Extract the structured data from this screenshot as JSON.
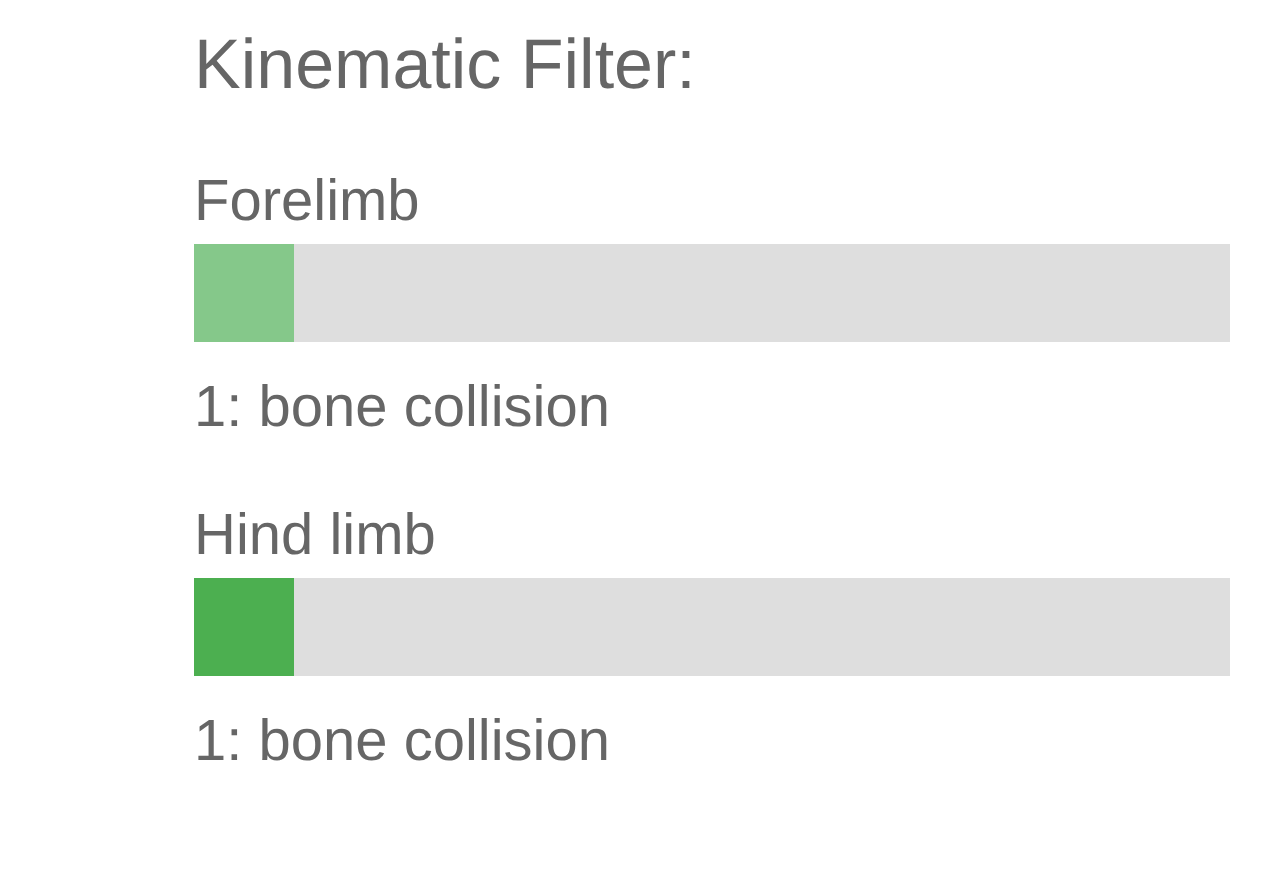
{
  "title": "Kinematic Filter:",
  "filters": [
    {
      "label": "Forelimb",
      "level": 0.097,
      "color": "#85c88a",
      "reading": "1: bone collision"
    },
    {
      "label": "Hind limb",
      "level": 0.097,
      "color": "#4caf50",
      "reading": "1: bone collision"
    }
  ]
}
